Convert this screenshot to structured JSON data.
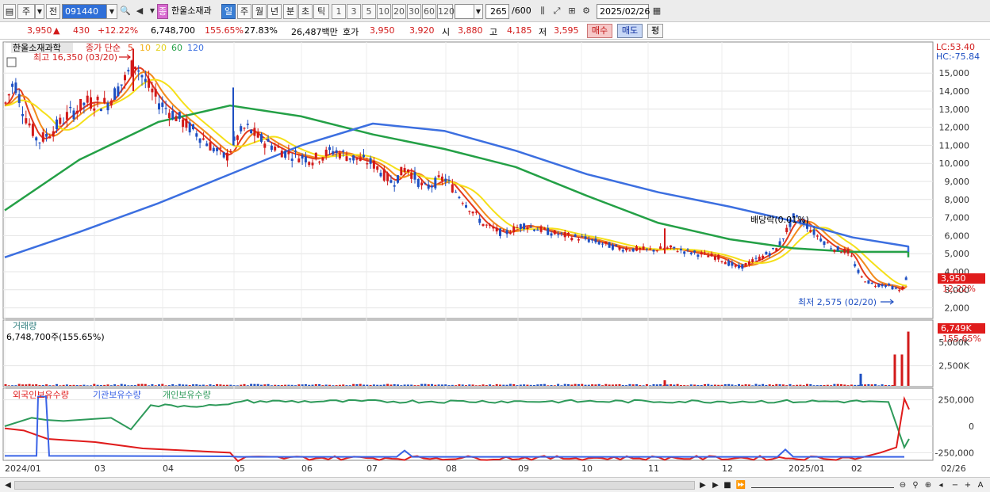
{
  "toolbar": {
    "chart_type_btn": "주",
    "compare_btn": "전",
    "code": "091440",
    "name_badge": "종",
    "stock_name": "한울소재과",
    "periods": [
      "일",
      "주",
      "월",
      "년",
      "분",
      "초",
      "틱"
    ],
    "intervals": [
      "1",
      "3",
      "5",
      "10",
      "20",
      "30",
      "60",
      "120"
    ],
    "count": "265",
    "count_total": "/600",
    "date": "2025/02/26"
  },
  "quote": {
    "price": "3,950",
    "change": "430",
    "change_pct": "+12.22%",
    "volume": "6,748,700",
    "volume_pct": "155.65%",
    "turnover": "27.83%",
    "amount": "26,487백만",
    "ask_label": "호가",
    "ask": "3,950",
    "bid": "3,920",
    "open_label": "시",
    "open": "3,880",
    "high_label": "고",
    "high": "4,185",
    "low_label": "저",
    "low": "3,595",
    "buy_btn": "매수",
    "sell_btn": "매도",
    "eval_btn": "평"
  },
  "price_panel": {
    "name_tag": "한울소재과학",
    "legend_title": "종가 단순",
    "ma_labels": [
      "5",
      "10",
      "20",
      "60",
      "120"
    ],
    "high_annotation": "최고 16,350 (03/20)",
    "low_annotation": "최저 2,575 (02/20)",
    "dividend_annotation": "배당락(0.01%)",
    "lc": "LC:53.40",
    "hc": "HC:-75.84",
    "current_badge": "3,950",
    "current_pct": "12.22%"
  },
  "volume_panel": {
    "title": "거래량",
    "value_text": "6,748,700주(155.65%)",
    "badge": "6,749K",
    "badge_pct": "155.65%",
    "partial_label": "5,000K"
  },
  "holdings_panel": {
    "foreign": "외국인보유수량",
    "institution": "기관보유수량",
    "individual": "개인보유수량"
  },
  "x_labels": [
    "2024/01",
    "03",
    "04",
    "05",
    "06",
    "07",
    "08",
    "09",
    "10",
    "11",
    "12",
    "2025/01",
    "02",
    "02/26"
  ],
  "colors": {
    "up": "#d21a1a",
    "down": "#1e4fc2",
    "ma5": "#e23b1e",
    "ma10": "#f28a1c",
    "ma20": "#f5e01a",
    "ma60": "#24a046",
    "ma120": "#3c6fe0",
    "foreign": "#e01c1c",
    "institution": "#3a63e6",
    "individual": "#2e9a5a"
  },
  "chart_data": [
    {
      "type": "line",
      "title": "한울소재과학",
      "y_ticks": [
        "2,000",
        "3,000",
        "4,000",
        "5,000",
        "6,000",
        "7,000",
        "8,000",
        "9,000",
        "10,000",
        "11,000",
        "12,000",
        "13,000",
        "14,000",
        "15,000"
      ],
      "ylim": [
        2000,
        16000
      ],
      "series": [
        {
          "name": "종가",
          "points": [
            [
              "2024/01",
              13200
            ],
            [
              "2024/01b",
              12500
            ],
            [
              "2024/02",
              11200
            ],
            [
              "2024/02b",
              12300
            ],
            [
              "2024/03",
              13400
            ],
            [
              "2024/03b",
              14300
            ],
            [
              "2024/04",
              13600
            ],
            [
              "2024/04b",
              12200
            ],
            [
              "2024/05",
              10300
            ],
            [
              "2024/05b",
              11900
            ],
            [
              "2024/06",
              11000
            ],
            [
              "2024/06b",
              10200
            ],
            [
              "2024/07",
              10500
            ],
            [
              "2024/07b",
              9200
            ],
            [
              "2024/08",
              8900
            ],
            [
              "2024/08b",
              7600
            ],
            [
              "2024/09",
              6200
            ],
            [
              "2024/09b",
              6300
            ],
            [
              "2024/10",
              5900
            ],
            [
              "2024/10b",
              5400
            ],
            [
              "2024/11",
              5200
            ],
            [
              "2024/11b",
              5100
            ],
            [
              "2024/12",
              4100
            ],
            [
              "2024/12b",
              5300
            ],
            [
              "2025/01",
              6400
            ],
            [
              "2025/01b",
              5200
            ],
            [
              "2025/02",
              3100
            ],
            [
              "2025/02b",
              3950
            ]
          ]
        },
        {
          "name": "60",
          "points": [
            [
              "2024/01",
              7400
            ],
            [
              "2024/02",
              10200
            ],
            [
              "2024/03",
              12300
            ],
            [
              "2024/04",
              13200
            ],
            [
              "2024/05",
              12600
            ],
            [
              "2024/06",
              11600
            ],
            [
              "2024/07",
              10800
            ],
            [
              "2024/08",
              9800
            ],
            [
              "2024/09",
              8200
            ],
            [
              "2024/10",
              6700
            ],
            [
              "2024/11",
              5800
            ],
            [
              "2024/12",
              5300
            ],
            [
              "2025/01",
              5100
            ],
            [
              "2025/02",
              5100
            ],
            [
              "2025/02b",
              4800
            ]
          ]
        },
        {
          "name": "120",
          "points": [
            [
              "2024/01",
              4800
            ],
            [
              "2024/02",
              6200
            ],
            [
              "2024/03",
              7800
            ],
            [
              "2024/04",
              9400
            ],
            [
              "2024/05",
              11000
            ],
            [
              "2024/06",
              12200
            ],
            [
              "2024/07",
              11800
            ],
            [
              "2024/08",
              10700
            ],
            [
              "2024/09",
              9400
            ],
            [
              "2024/10",
              8400
            ],
            [
              "2024/11",
              7600
            ],
            [
              "2024/12",
              6800
            ],
            [
              "2025/01",
              5900
            ],
            [
              "2025/02",
              5400
            ],
            [
              "2025/02b",
              5100
            ]
          ]
        }
      ]
    },
    {
      "type": "bar",
      "title": "거래량",
      "y_ticks": [
        "2,500K"
      ],
      "spikes": [
        {
          "x": "2024/11",
          "value": 700
        },
        {
          "x": "2025/02",
          "value": 1500
        },
        {
          "x": "2025/02b",
          "value": 3900
        },
        {
          "x": "2025/02c",
          "value": 3900
        },
        {
          "x": "2025/02/26",
          "value": 6749
        }
      ],
      "unit": "K"
    },
    {
      "type": "line",
      "title": "보유수량",
      "y_ticks": [
        "250,000",
        "0",
        "-250,000"
      ],
      "series": [
        {
          "name": "외국인보유수량",
          "level": "low, spikes to 250,000 at end"
        },
        {
          "name": "기관보유수량",
          "level": "spike to 250,000 in 2024/01, then low"
        },
        {
          "name": "개인보유수량",
          "level": "around 250,000, drops at end"
        }
      ]
    }
  ]
}
